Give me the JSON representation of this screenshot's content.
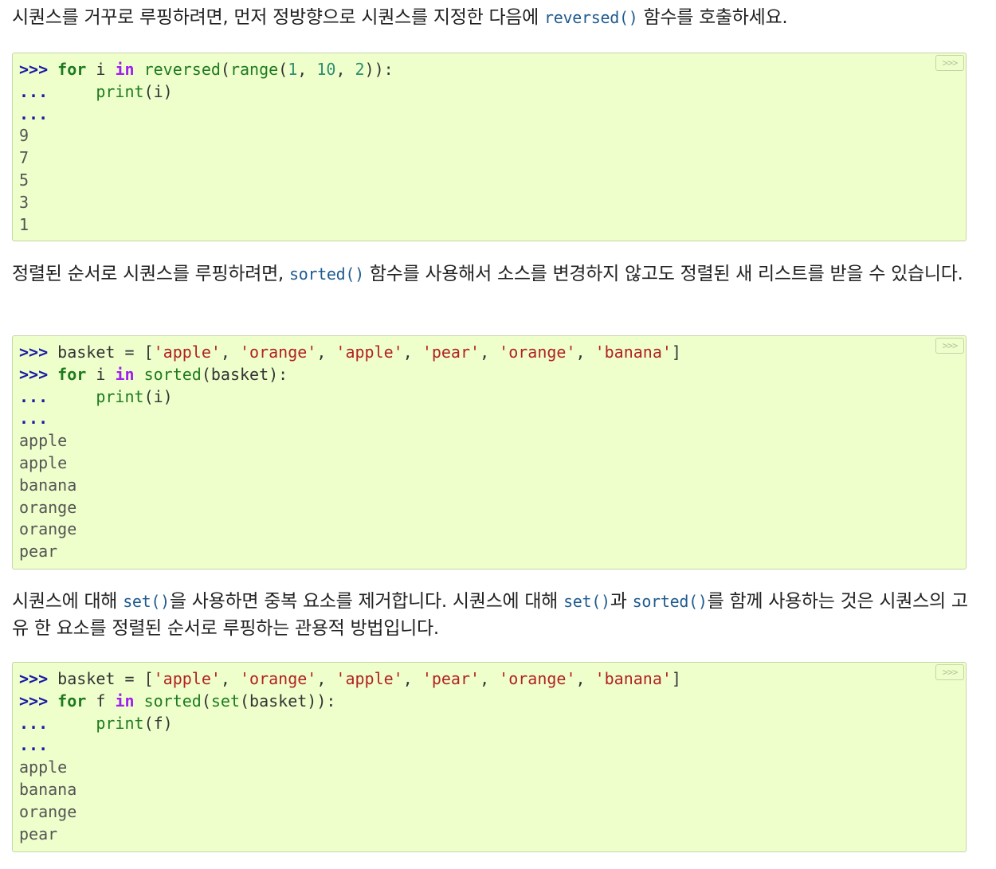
{
  "paragraphs": [
    {
      "before": "시퀀스를 거꾸로 루핑하려면, 먼저 정방향으로 시퀀스를 지정한 다음에 ",
      "code1": "reversed()",
      "after": " 함수를 호출하세요."
    },
    {
      "before": "정렬된 순서로 시퀀스를 루핑하려면, ",
      "code1": "sorted()",
      "after": " 함수를 사용해서 소스를 변경하지 않고도 정렬된 새 리스트를 받을 수 있습니다."
    },
    {
      "before": "시퀀스에 대해 ",
      "code1": "set()",
      "mid1": "을 사용하면 중복 요소를 제거합니다. 시퀀스에 대해 ",
      "code2": "set()",
      "mid2": "과 ",
      "code3": "sorted()",
      "after": "를 함께 사용하는 것은 시퀀스의 고유 한 요소를 정렬된 순서로 루핑하는 관용적 방법입니다."
    }
  ],
  "copy_button_label": ">>>",
  "code_blocks": [
    {
      "prompt": ">>>",
      "cont": "...",
      "for": "for",
      "var": "i",
      "in": "in",
      "fn1": "reversed",
      "fn2": "range",
      "n1": "1",
      "n2": "10",
      "n3": "2",
      "print": "print",
      "output": [
        "9",
        "7",
        "5",
        "3",
        "1"
      ]
    },
    {
      "prompt": ">>>",
      "cont": "...",
      "assign_name": "basket",
      "items": [
        "'apple'",
        "'orange'",
        "'apple'",
        "'pear'",
        "'orange'",
        "'banana'"
      ],
      "for": "for",
      "var": "i",
      "in": "in",
      "fn1": "sorted",
      "print": "print",
      "output": [
        "apple",
        "apple",
        "banana",
        "orange",
        "orange",
        "pear"
      ]
    },
    {
      "prompt": ">>>",
      "cont": "...",
      "assign_name": "basket",
      "items": [
        "'apple'",
        "'orange'",
        "'apple'",
        "'pear'",
        "'orange'",
        "'banana'"
      ],
      "for": "for",
      "var": "f",
      "in": "in",
      "fn1": "sorted",
      "fn2": "set",
      "print": "print",
      "output": [
        "apple",
        "banana",
        "orange",
        "pear"
      ]
    }
  ]
}
